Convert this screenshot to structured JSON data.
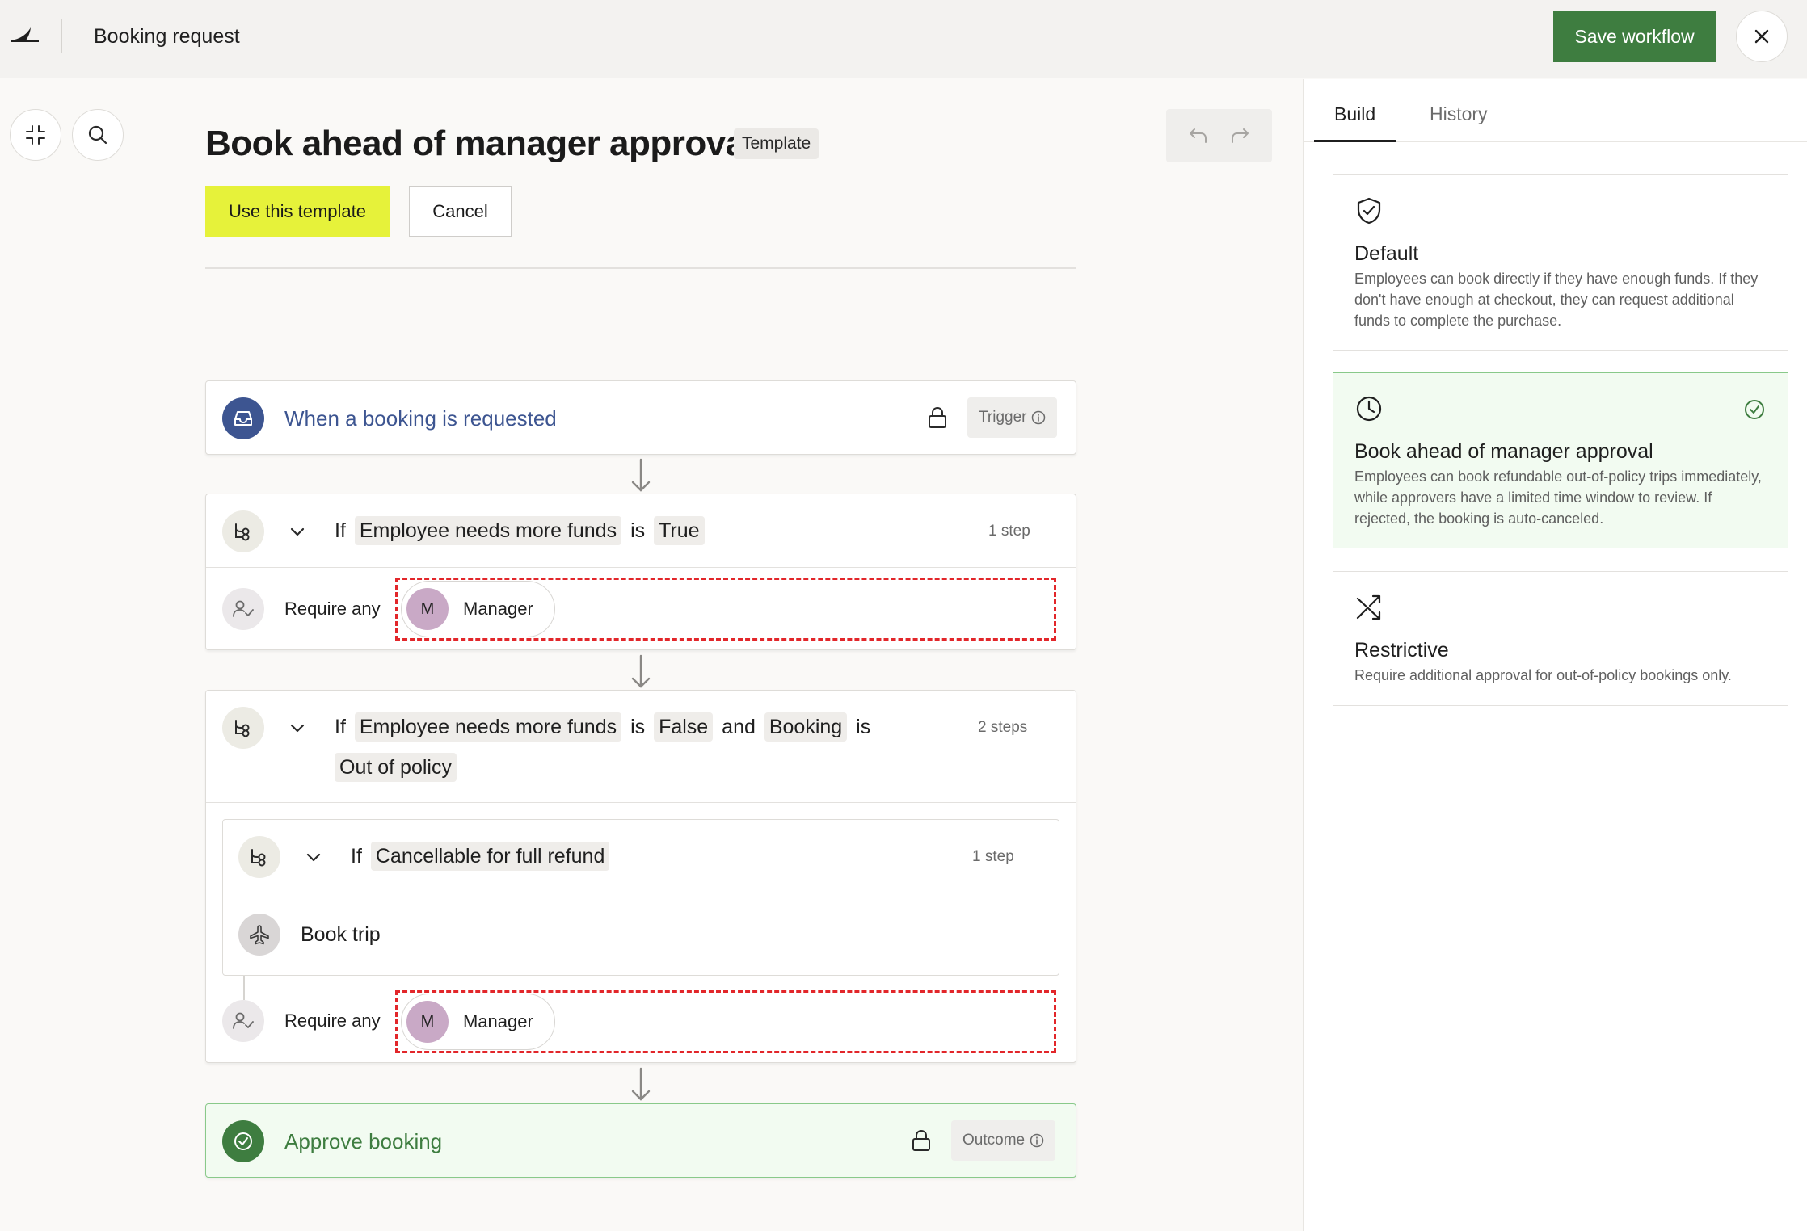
{
  "topbar": {
    "title": "Booking request",
    "save_label": "Save workflow"
  },
  "canvas": {
    "page_title": "Book ahead of manager approval",
    "template_badge": "Template",
    "use_template_label": "Use this template",
    "cancel_label": "Cancel",
    "trigger": {
      "label": "When a booking is requested",
      "tag": "Trigger"
    },
    "branch1": {
      "if": "If",
      "field": "Employee needs more funds",
      "is": "is",
      "value": "True",
      "steps": "1 step",
      "require_label": "Require any",
      "approver_initial": "M",
      "approver_name": "Manager"
    },
    "branch2": {
      "if": "If",
      "field": "Employee needs more funds",
      "is": "is",
      "value": "False",
      "and": "and",
      "field2": "Booking",
      "is2": "is",
      "value2": "Out of policy",
      "steps": "2 steps",
      "nested": {
        "if": "If",
        "field": "Cancellable for full refund",
        "steps": "1 step",
        "action": "Book trip"
      },
      "require_label": "Require any",
      "approver_initial": "M",
      "approver_name": "Manager"
    },
    "outcome": {
      "label": "Approve booking",
      "tag": "Outcome"
    }
  },
  "side": {
    "tabs": [
      {
        "label": "Build",
        "active": true
      },
      {
        "label": "History",
        "active": false
      }
    ],
    "options": [
      {
        "icon": "shield-check-icon",
        "title": "Default",
        "description": "Employees can book directly if they have enough funds. If they don't have enough at checkout, they can request additional funds to complete the purchase.",
        "selected": false
      },
      {
        "icon": "clock-icon",
        "title": "Book ahead of manager approval",
        "description": "Employees can book refundable out-of-policy trips immediately, while approvers have a limited time window to review. If rejected, the booking is auto-canceled.",
        "selected": true
      },
      {
        "icon": "shuffle-icon",
        "title": "Restrictive",
        "description": "Require additional approval for out-of-policy bookings only.",
        "selected": false
      }
    ]
  },
  "colors": {
    "primary_green": "#3e7d40",
    "accent_yellow": "#e6f23a",
    "trigger_blue": "#3d5591",
    "highlight_red": "#e2262a",
    "selected_bg": "#f2fbf1"
  }
}
